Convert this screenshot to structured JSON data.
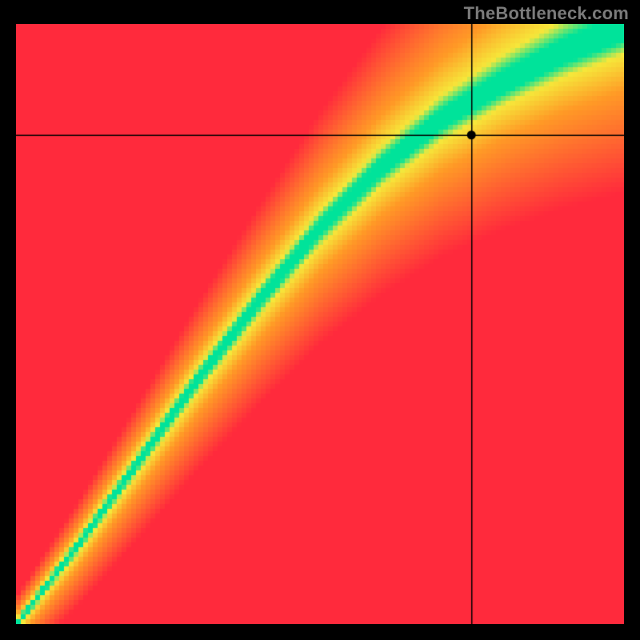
{
  "watermark": "TheBottleneck.com",
  "chart_data": {
    "type": "heatmap",
    "title": "",
    "xlabel": "",
    "ylabel": "",
    "x_range": [
      0,
      1
    ],
    "y_range": [
      0,
      1
    ],
    "crosshair": {
      "x": 0.749,
      "y": 0.815
    },
    "marker": {
      "x": 0.749,
      "y": 0.815
    },
    "ridge": {
      "description": "Green optimal band centerline; y as function of x (normalized 0..1). Piecewise linear, slightly super-linear early then tapering.",
      "points": [
        {
          "x": 0.0,
          "y": 0.0
        },
        {
          "x": 0.1,
          "y": 0.13
        },
        {
          "x": 0.2,
          "y": 0.27
        },
        {
          "x": 0.3,
          "y": 0.41
        },
        {
          "x": 0.4,
          "y": 0.54
        },
        {
          "x": 0.5,
          "y": 0.66
        },
        {
          "x": 0.6,
          "y": 0.76
        },
        {
          "x": 0.7,
          "y": 0.84
        },
        {
          "x": 0.8,
          "y": 0.9
        },
        {
          "x": 0.9,
          "y": 0.95
        },
        {
          "x": 1.0,
          "y": 0.99
        }
      ]
    },
    "band_half_width_start": 0.01,
    "band_half_width_end": 0.06,
    "colors": {
      "optimal": "#00e39a",
      "near": "#f6e73a",
      "mid": "#ff9a26",
      "far": "#ff2a3c"
    }
  }
}
